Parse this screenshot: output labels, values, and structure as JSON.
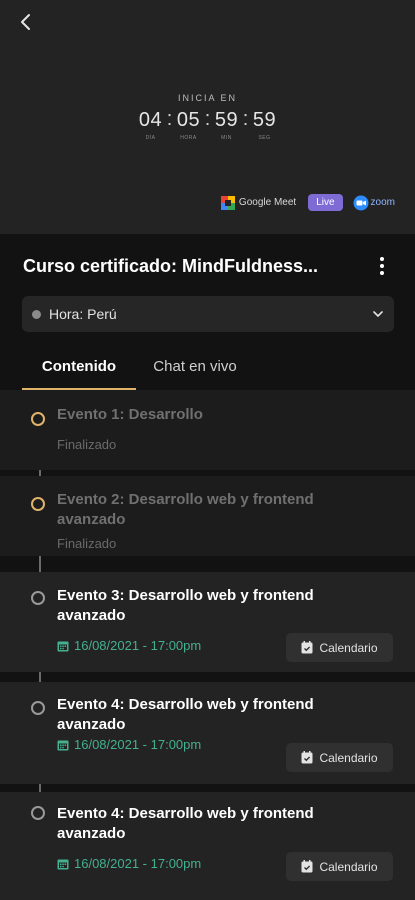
{
  "hero": {
    "starts_label": "INICIA EN",
    "countdown": [
      {
        "value": "04",
        "unit": "DÍA"
      },
      {
        "value": "05",
        "unit": "HORA"
      },
      {
        "value": "59",
        "unit": "MIN"
      },
      {
        "value": "59",
        "unit": "SEG"
      }
    ],
    "platforms": {
      "google_meet": "Google Meet",
      "live": "Live",
      "zoom": "zoom"
    }
  },
  "course": {
    "title": "Curso certificado: MindFuldness...",
    "timezone": "Hora: Perú"
  },
  "tabs": [
    "Contenido",
    "Chat en vivo"
  ],
  "events": [
    {
      "title": "Evento 1: Desarrollo",
      "status": "Finalizado"
    },
    {
      "title": "Evento 2: Desarrollo web y frontend avanzado",
      "status": "Finalizado"
    },
    {
      "title": "Evento 3: Desarrollo web y frontend avanzado",
      "date": "16/08/2021 - 17:00pm",
      "button": "Calendario"
    },
    {
      "title": "Evento 4: Desarrollo web y frontend avanzado",
      "date": "16/08/2021 - 17:00pm",
      "button": "Calendario"
    },
    {
      "title": "Evento 4: Desarrollo web y frontend avanzado",
      "date": "16/08/2021 - 17:00pm",
      "button": "Calendario"
    }
  ],
  "colors": {
    "accent_gold": "#e0b36a",
    "date_green": "#43b08f",
    "live_purple": "#7e6bd3"
  }
}
